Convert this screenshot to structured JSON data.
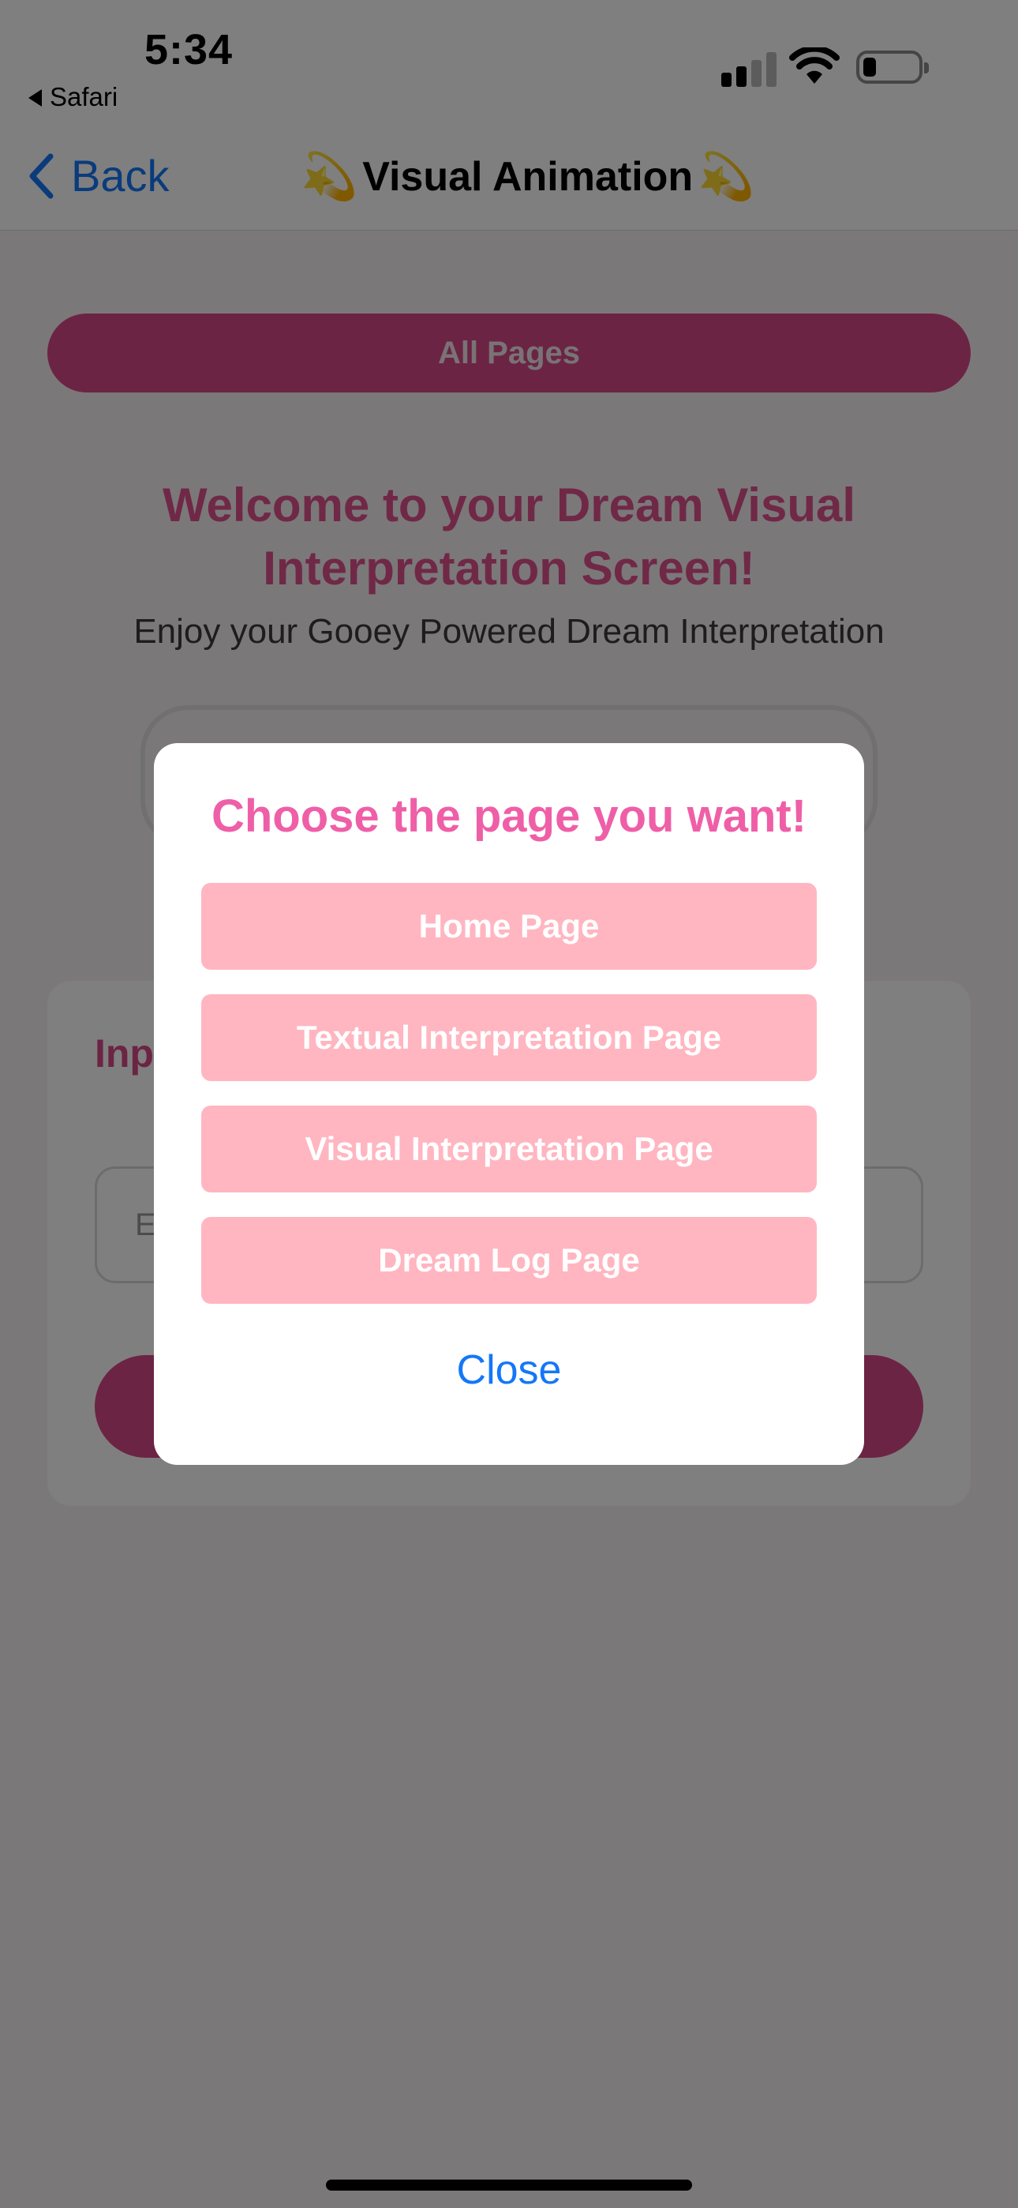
{
  "status_bar": {
    "time": "5:34",
    "back_app": "Safari"
  },
  "nav": {
    "back_label": "Back",
    "title": "Visual Animation",
    "title_emoji": "💫"
  },
  "page": {
    "all_pages_label": "All Pages",
    "welcome_title": "Welcome to your Dream Visual Interpretation Screen!",
    "welcome_subtitle": "Enjoy your Gooey Powered Dream Interpretation",
    "card_title_visible": "Inp you",
    "input_placeholder_visible": "E"
  },
  "modal": {
    "title": "Choose the page you want!",
    "options": [
      {
        "label": "Home Page"
      },
      {
        "label": "Textual Interpretation Page"
      },
      {
        "label": "Visual Interpretation Page"
      },
      {
        "label": "Dream Log Page"
      }
    ],
    "close_label": "Close"
  },
  "colors": {
    "accent_pink": "#d94889",
    "modal_title_pink": "#ef5fa7",
    "option_pink": "#ffb6c1",
    "ios_blue": "#1477f8"
  }
}
